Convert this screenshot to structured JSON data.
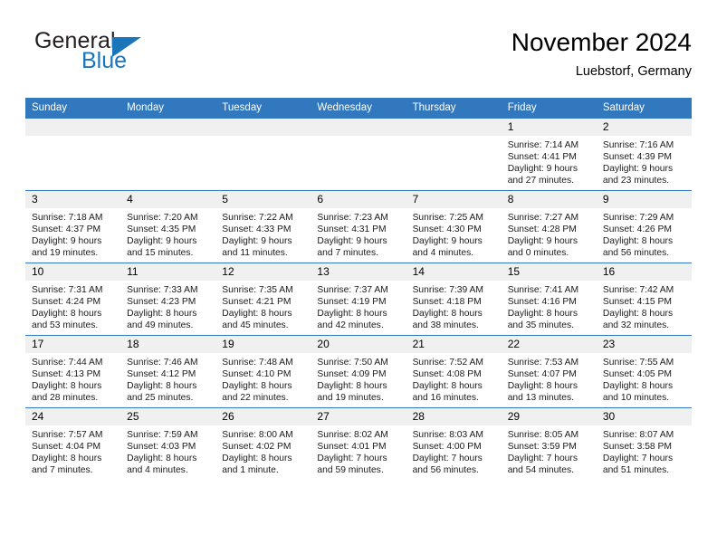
{
  "logo": {
    "word_one": "General",
    "word_two": "Blue",
    "triangle_icon": "blue-triangle-icon",
    "color_dark": "#231f20",
    "color_blue": "#1b75bb"
  },
  "header": {
    "title": "November 2024",
    "subtitle": "Luebstorf, Germany"
  },
  "theme": {
    "header_blue": "#3278be",
    "daynum_gray": "#f0f0f0",
    "text": "#000000"
  },
  "calendar": {
    "weekday_headers": [
      "Sunday",
      "Monday",
      "Tuesday",
      "Wednesday",
      "Thursday",
      "Friday",
      "Saturday"
    ],
    "weeks": [
      [
        {
          "day": "",
          "lines": []
        },
        {
          "day": "",
          "lines": []
        },
        {
          "day": "",
          "lines": []
        },
        {
          "day": "",
          "lines": []
        },
        {
          "day": "",
          "lines": []
        },
        {
          "day": "1",
          "lines": [
            "Sunrise: 7:14 AM",
            "Sunset: 4:41 PM",
            "Daylight: 9 hours",
            "and 27 minutes."
          ]
        },
        {
          "day": "2",
          "lines": [
            "Sunrise: 7:16 AM",
            "Sunset: 4:39 PM",
            "Daylight: 9 hours",
            "and 23 minutes."
          ]
        }
      ],
      [
        {
          "day": "3",
          "lines": [
            "Sunrise: 7:18 AM",
            "Sunset: 4:37 PM",
            "Daylight: 9 hours",
            "and 19 minutes."
          ]
        },
        {
          "day": "4",
          "lines": [
            "Sunrise: 7:20 AM",
            "Sunset: 4:35 PM",
            "Daylight: 9 hours",
            "and 15 minutes."
          ]
        },
        {
          "day": "5",
          "lines": [
            "Sunrise: 7:22 AM",
            "Sunset: 4:33 PM",
            "Daylight: 9 hours",
            "and 11 minutes."
          ]
        },
        {
          "day": "6",
          "lines": [
            "Sunrise: 7:23 AM",
            "Sunset: 4:31 PM",
            "Daylight: 9 hours",
            "and 7 minutes."
          ]
        },
        {
          "day": "7",
          "lines": [
            "Sunrise: 7:25 AM",
            "Sunset: 4:30 PM",
            "Daylight: 9 hours",
            "and 4 minutes."
          ]
        },
        {
          "day": "8",
          "lines": [
            "Sunrise: 7:27 AM",
            "Sunset: 4:28 PM",
            "Daylight: 9 hours",
            "and 0 minutes."
          ]
        },
        {
          "day": "9",
          "lines": [
            "Sunrise: 7:29 AM",
            "Sunset: 4:26 PM",
            "Daylight: 8 hours",
            "and 56 minutes."
          ]
        }
      ],
      [
        {
          "day": "10",
          "lines": [
            "Sunrise: 7:31 AM",
            "Sunset: 4:24 PM",
            "Daylight: 8 hours",
            "and 53 minutes."
          ]
        },
        {
          "day": "11",
          "lines": [
            "Sunrise: 7:33 AM",
            "Sunset: 4:23 PM",
            "Daylight: 8 hours",
            "and 49 minutes."
          ]
        },
        {
          "day": "12",
          "lines": [
            "Sunrise: 7:35 AM",
            "Sunset: 4:21 PM",
            "Daylight: 8 hours",
            "and 45 minutes."
          ]
        },
        {
          "day": "13",
          "lines": [
            "Sunrise: 7:37 AM",
            "Sunset: 4:19 PM",
            "Daylight: 8 hours",
            "and 42 minutes."
          ]
        },
        {
          "day": "14",
          "lines": [
            "Sunrise: 7:39 AM",
            "Sunset: 4:18 PM",
            "Daylight: 8 hours",
            "and 38 minutes."
          ]
        },
        {
          "day": "15",
          "lines": [
            "Sunrise: 7:41 AM",
            "Sunset: 4:16 PM",
            "Daylight: 8 hours",
            "and 35 minutes."
          ]
        },
        {
          "day": "16",
          "lines": [
            "Sunrise: 7:42 AM",
            "Sunset: 4:15 PM",
            "Daylight: 8 hours",
            "and 32 minutes."
          ]
        }
      ],
      [
        {
          "day": "17",
          "lines": [
            "Sunrise: 7:44 AM",
            "Sunset: 4:13 PM",
            "Daylight: 8 hours",
            "and 28 minutes."
          ]
        },
        {
          "day": "18",
          "lines": [
            "Sunrise: 7:46 AM",
            "Sunset: 4:12 PM",
            "Daylight: 8 hours",
            "and 25 minutes."
          ]
        },
        {
          "day": "19",
          "lines": [
            "Sunrise: 7:48 AM",
            "Sunset: 4:10 PM",
            "Daylight: 8 hours",
            "and 22 minutes."
          ]
        },
        {
          "day": "20",
          "lines": [
            "Sunrise: 7:50 AM",
            "Sunset: 4:09 PM",
            "Daylight: 8 hours",
            "and 19 minutes."
          ]
        },
        {
          "day": "21",
          "lines": [
            "Sunrise: 7:52 AM",
            "Sunset: 4:08 PM",
            "Daylight: 8 hours",
            "and 16 minutes."
          ]
        },
        {
          "day": "22",
          "lines": [
            "Sunrise: 7:53 AM",
            "Sunset: 4:07 PM",
            "Daylight: 8 hours",
            "and 13 minutes."
          ]
        },
        {
          "day": "23",
          "lines": [
            "Sunrise: 7:55 AM",
            "Sunset: 4:05 PM",
            "Daylight: 8 hours",
            "and 10 minutes."
          ]
        }
      ],
      [
        {
          "day": "24",
          "lines": [
            "Sunrise: 7:57 AM",
            "Sunset: 4:04 PM",
            "Daylight: 8 hours",
            "and 7 minutes."
          ]
        },
        {
          "day": "25",
          "lines": [
            "Sunrise: 7:59 AM",
            "Sunset: 4:03 PM",
            "Daylight: 8 hours",
            "and 4 minutes."
          ]
        },
        {
          "day": "26",
          "lines": [
            "Sunrise: 8:00 AM",
            "Sunset: 4:02 PM",
            "Daylight: 8 hours",
            "and 1 minute."
          ]
        },
        {
          "day": "27",
          "lines": [
            "Sunrise: 8:02 AM",
            "Sunset: 4:01 PM",
            "Daylight: 7 hours",
            "and 59 minutes."
          ]
        },
        {
          "day": "28",
          "lines": [
            "Sunrise: 8:03 AM",
            "Sunset: 4:00 PM",
            "Daylight: 7 hours",
            "and 56 minutes."
          ]
        },
        {
          "day": "29",
          "lines": [
            "Sunrise: 8:05 AM",
            "Sunset: 3:59 PM",
            "Daylight: 7 hours",
            "and 54 minutes."
          ]
        },
        {
          "day": "30",
          "lines": [
            "Sunrise: 8:07 AM",
            "Sunset: 3:58 PM",
            "Daylight: 7 hours",
            "and 51 minutes."
          ]
        }
      ]
    ]
  }
}
